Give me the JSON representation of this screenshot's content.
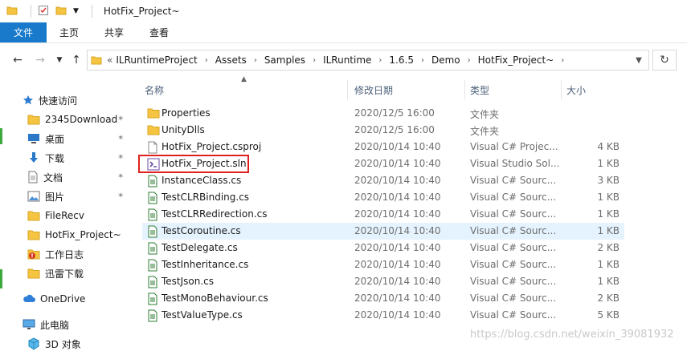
{
  "window": {
    "title": "HotFix_Project~"
  },
  "ribbon": {
    "tabs": [
      "文件",
      "主页",
      "共享",
      "查看"
    ]
  },
  "address": {
    "overflow": "«",
    "crumbs": [
      "ILRuntimeProject",
      "Assets",
      "Samples",
      "ILRuntime",
      "1.6.5",
      "Demo",
      "HotFix_Project~"
    ]
  },
  "columns": {
    "name": "名称",
    "date": "修改日期",
    "type": "类型",
    "size": "大小"
  },
  "sidebar": {
    "quick_access": "快速访问",
    "items": [
      {
        "label": "2345Download",
        "icon": "folder-icon",
        "pinned": true
      },
      {
        "label": "桌面",
        "icon": "desktop-icon",
        "pinned": true
      },
      {
        "label": "下载",
        "icon": "download-icon",
        "pinned": true
      },
      {
        "label": "文档",
        "icon": "document-icon",
        "pinned": true
      },
      {
        "label": "图片",
        "icon": "picture-icon",
        "pinned": true
      },
      {
        "label": "FileRecv",
        "icon": "folder-icon",
        "pinned": false
      },
      {
        "label": "HotFix_Project~",
        "icon": "folder-icon",
        "pinned": false
      },
      {
        "label": "工作日志",
        "icon": "folder-warning-icon",
        "pinned": false
      },
      {
        "label": "迅雷下载",
        "icon": "folder-icon",
        "pinned": false
      }
    ],
    "onedrive": "OneDrive",
    "this_pc": "此电脑",
    "objects_3d": "3D 对象"
  },
  "files": [
    {
      "name": "Properties",
      "date": "2020/12/5 16:00",
      "type": "文件夹",
      "size": "",
      "icon": "folder-icon"
    },
    {
      "name": "UnityDlls",
      "date": "2020/12/5 16:00",
      "type": "文件夹",
      "size": "",
      "icon": "folder-icon"
    },
    {
      "name": "HotFix_Project.csproj",
      "date": "2020/10/14 10:40",
      "type": "Visual C# Projec...",
      "size": "4 KB",
      "icon": "csproj-file-icon"
    },
    {
      "name": "HotFix_Project.sln",
      "date": "2020/10/14 10:40",
      "type": "Visual Studio Sol...",
      "size": "1 KB",
      "icon": "visual-studio-solution-icon"
    },
    {
      "name": "InstanceClass.cs",
      "date": "2020/10/14 10:40",
      "type": "Visual C# Sourc...",
      "size": "3 KB",
      "icon": "cs-file-icon"
    },
    {
      "name": "TestCLRBinding.cs",
      "date": "2020/10/14 10:40",
      "type": "Visual C# Sourc...",
      "size": "1 KB",
      "icon": "cs-file-icon"
    },
    {
      "name": "TestCLRRedirection.cs",
      "date": "2020/10/14 10:40",
      "type": "Visual C# Sourc...",
      "size": "1 KB",
      "icon": "cs-file-icon"
    },
    {
      "name": "TestCoroutine.cs",
      "date": "2020/10/14 10:40",
      "type": "Visual C# Sourc...",
      "size": "1 KB",
      "icon": "cs-file-icon"
    },
    {
      "name": "TestDelegate.cs",
      "date": "2020/10/14 10:40",
      "type": "Visual C# Sourc...",
      "size": "2 KB",
      "icon": "cs-file-icon"
    },
    {
      "name": "TestInheritance.cs",
      "date": "2020/10/14 10:40",
      "type": "Visual C# Sourc...",
      "size": "1 KB",
      "icon": "cs-file-icon"
    },
    {
      "name": "TestJson.cs",
      "date": "2020/10/14 10:40",
      "type": "Visual C# Sourc...",
      "size": "1 KB",
      "icon": "cs-file-icon"
    },
    {
      "name": "TestMonoBehaviour.cs",
      "date": "2020/10/14 10:40",
      "type": "Visual C# Sourc...",
      "size": "2 KB",
      "icon": "cs-file-icon"
    },
    {
      "name": "TestValueType.cs",
      "date": "2020/10/14 10:40",
      "type": "Visual C# Sourc...",
      "size": "5 KB",
      "icon": "cs-file-icon"
    }
  ],
  "selected_file": "TestCoroutine.cs",
  "highlighted_file": "HotFix_Project.sln",
  "watermark": "https://blog.csdn.net/weixin_39081932",
  "colors": {
    "accent": "#1979ca",
    "selection": "#e5f3ff",
    "highlight_border": "#e0201c",
    "folder": "#f5c542"
  }
}
